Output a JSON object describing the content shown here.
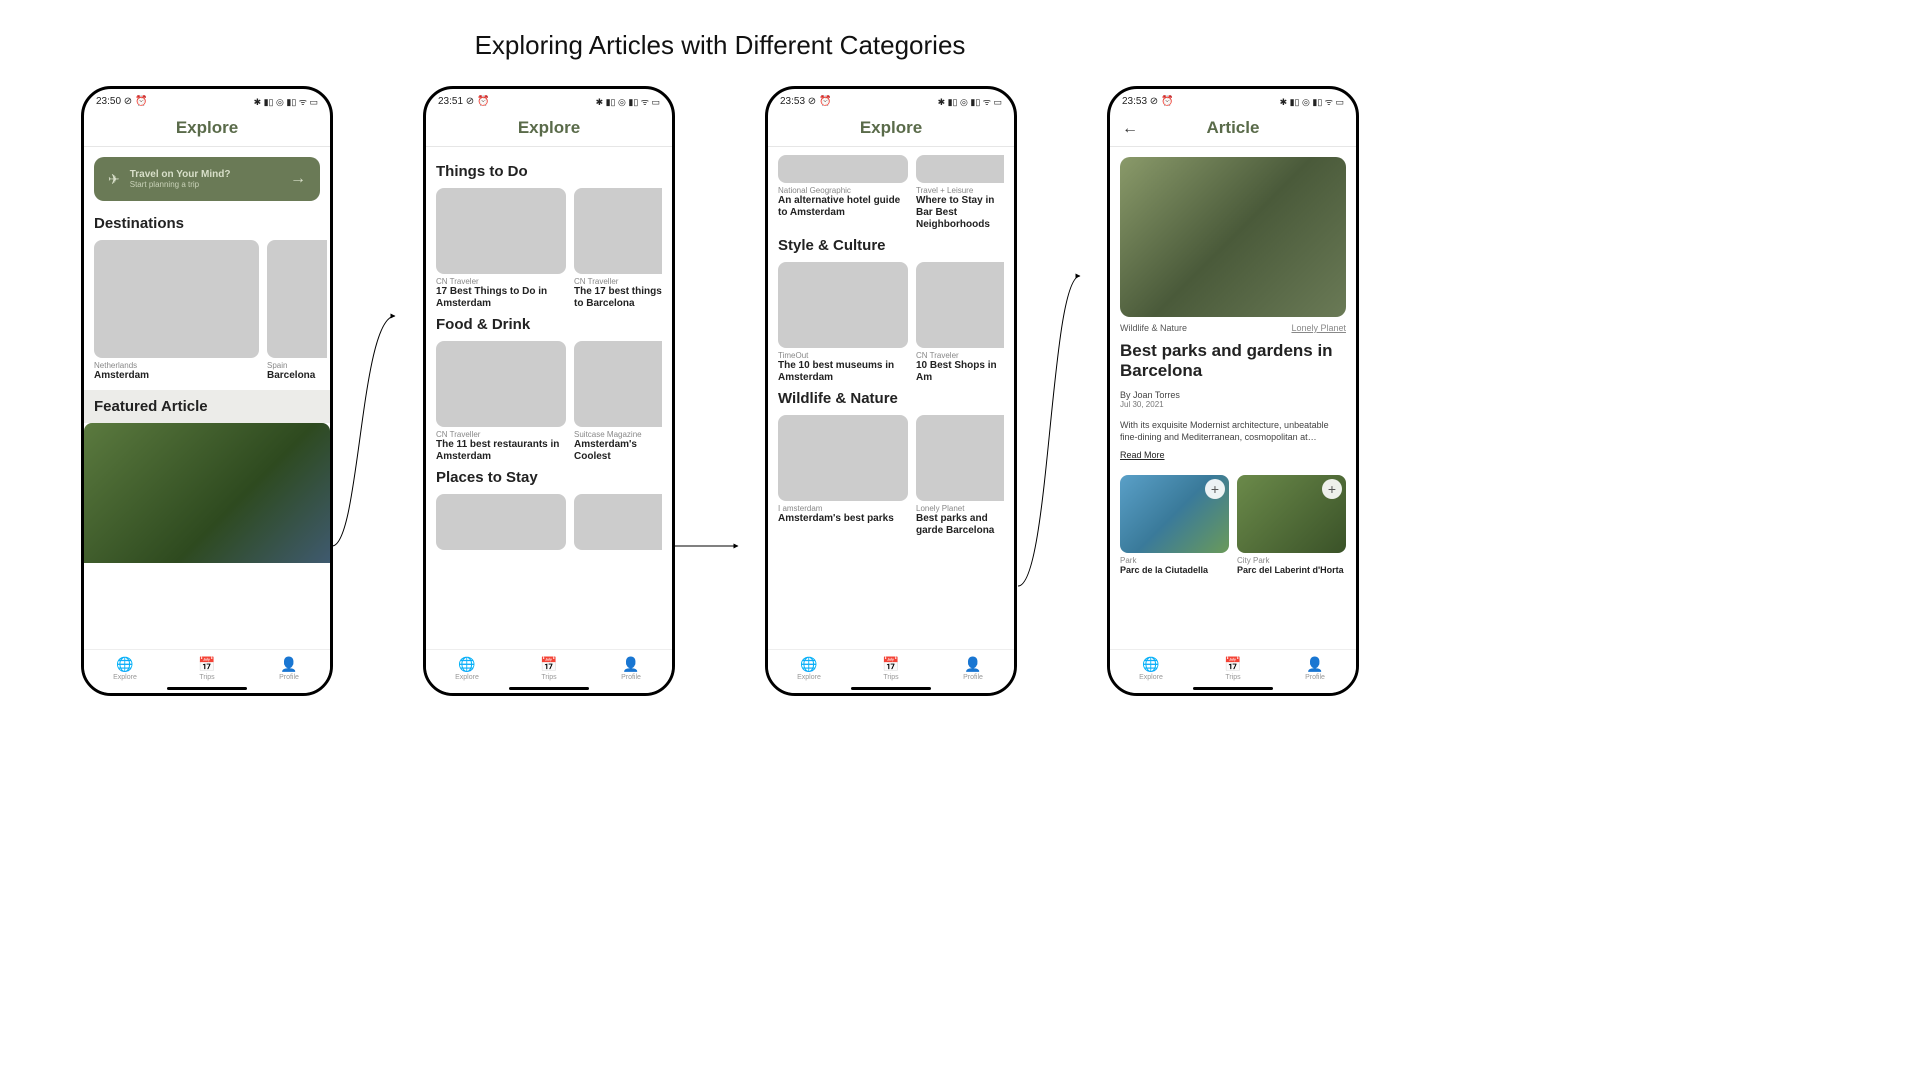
{
  "page_heading": "Exploring Articles with Different Categories",
  "nav": {
    "explore": "Explore",
    "trips": "Trips",
    "profile": "Profile"
  },
  "screens": [
    {
      "status_time": "23:50",
      "header": "Explore",
      "promo": {
        "line1": "Travel on Your Mind?",
        "line2": "Start planning a trip"
      },
      "destinations_title": "Destinations",
      "destinations": [
        {
          "country": "Netherlands",
          "city": "Amsterdam"
        },
        {
          "country": "Spain",
          "city": "Barcelona"
        }
      ],
      "featured_title": "Featured Article"
    },
    {
      "status_time": "23:51",
      "header": "Explore",
      "sections": [
        {
          "title": "Things to Do",
          "items": [
            {
              "source": "CN Traveler",
              "title": "17 Best Things to Do in Amsterdam"
            },
            {
              "source": "CN Traveller",
              "title": "The 17 best things to Barcelona"
            }
          ]
        },
        {
          "title": "Food & Drink",
          "items": [
            {
              "source": "CN Traveller",
              "title": "The 11 best restaurants in Amsterdam"
            },
            {
              "source": "Suitcase Magazine",
              "title": "Amsterdam's Coolest"
            }
          ]
        },
        {
          "title": "Places to Stay",
          "items": []
        }
      ]
    },
    {
      "status_time": "23:53",
      "header": "Explore",
      "top_items": [
        {
          "source": "National Geographic",
          "title": "An alternative hotel guide to Amsterdam"
        },
        {
          "source": "Travel + Leisure",
          "title": "Where to Stay in Bar Best Neighborhoods"
        }
      ],
      "sections": [
        {
          "title": "Style & Culture",
          "items": [
            {
              "source": "TimeOut",
              "title": "The 10 best museums in Amsterdam"
            },
            {
              "source": "CN Traveler",
              "title": "10 Best Shops in Am"
            }
          ]
        },
        {
          "title": "Wildlife & Nature",
          "items": [
            {
              "source": "I amsterdam",
              "title": "Amsterdam's best parks"
            },
            {
              "source": "Lonely Planet",
              "title": "Best parks and garde Barcelona"
            }
          ]
        }
      ]
    },
    {
      "status_time": "23:53",
      "header": "Article",
      "category": "Wildlife & Nature",
      "source_link": "Lonely Planet",
      "title": "Best parks and gardens in Barcelona",
      "author": "By Joan Torres",
      "date": "Jul 30, 2021",
      "body": "With its exquisite Modernist architecture, unbeatable fine-dining and Mediterranean, cosmopolitan at…",
      "read_more": "Read More",
      "places": [
        {
          "type": "Park",
          "name": "Parc de la Ciutadella"
        },
        {
          "type": "City Park",
          "name": "Parc del Laberint d'Horta"
        }
      ]
    }
  ]
}
